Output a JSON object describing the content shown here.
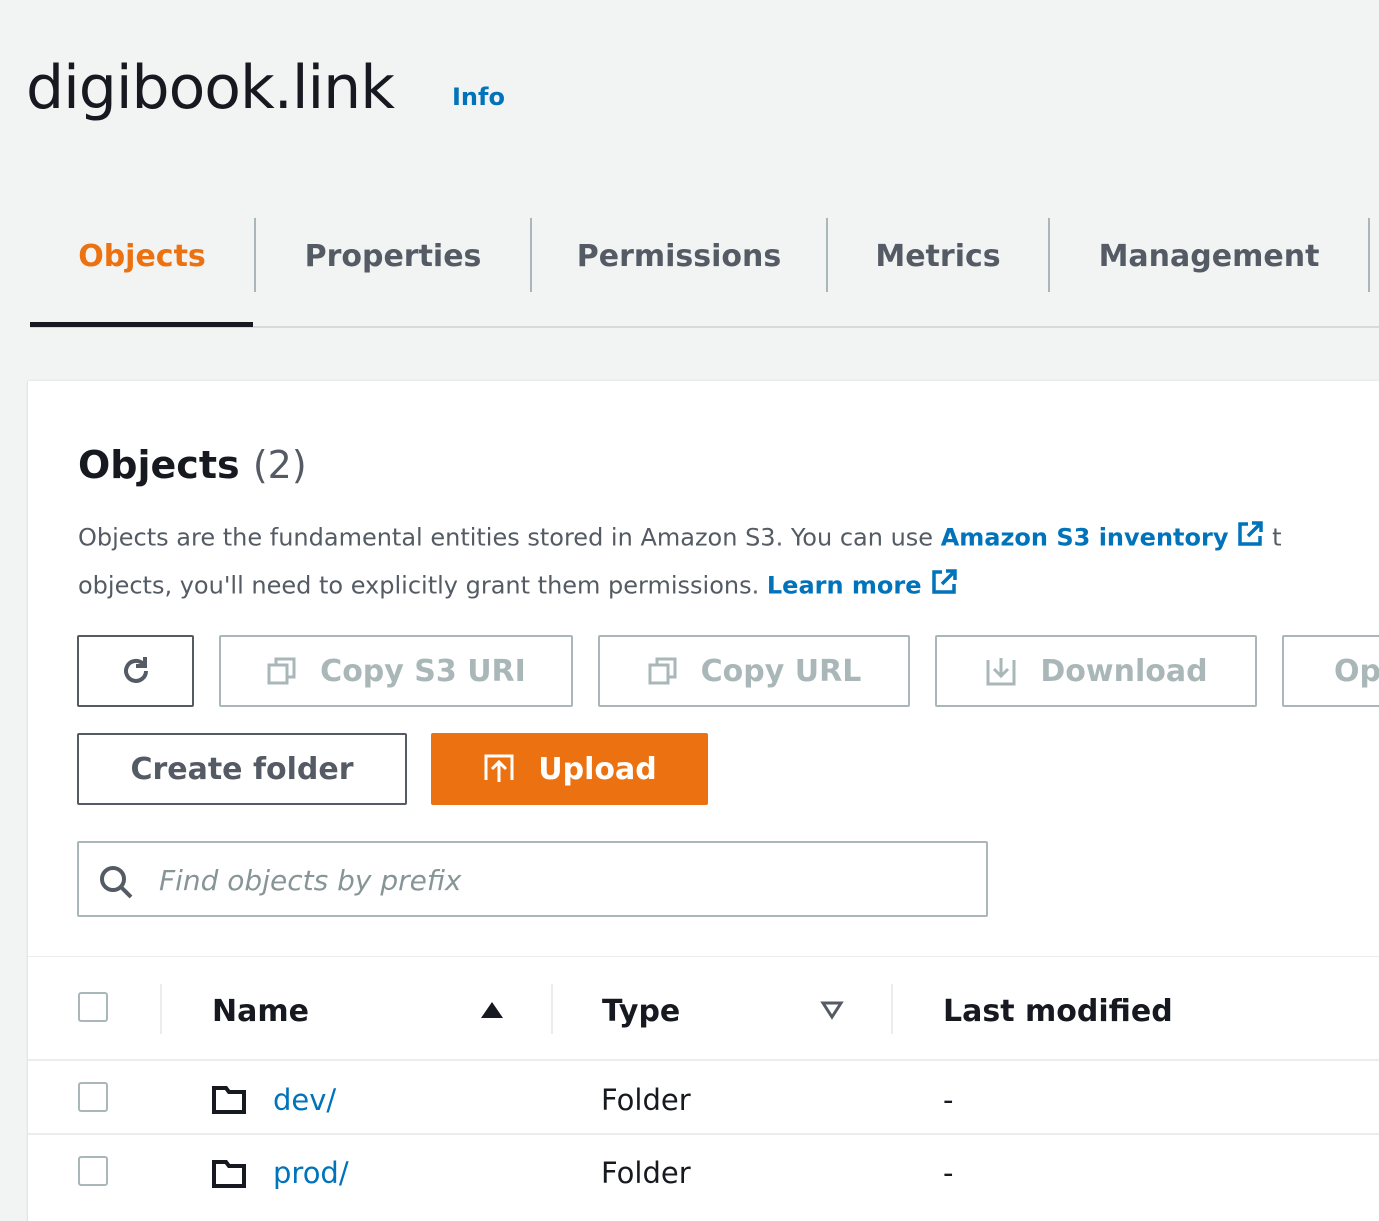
{
  "page": {
    "title": "digibook.link",
    "info_label": "Info"
  },
  "tabs": [
    "Objects",
    "Properties",
    "Permissions",
    "Metrics",
    "Management"
  ],
  "active_tab": "Objects",
  "objects_panel": {
    "heading": "Objects",
    "count": "(2)",
    "description_line1_text": "Objects are the fundamental entities stored in Amazon S3. You can use ",
    "description_line1_link": "Amazon S3 inventory",
    "description_line1_trail": "t",
    "description_line2_text": "objects, you'll need to explicitly grant them permissions. ",
    "description_line2_link": "Learn more"
  },
  "actions": {
    "refresh_icon": "refresh-icon",
    "copy_s3_uri": "Copy S3 URI",
    "copy_url": "Copy URL",
    "download": "Download",
    "open": "Op",
    "create_folder": "Create folder",
    "upload": "Upload"
  },
  "search": {
    "placeholder": "Find objects by prefix",
    "value": ""
  },
  "table": {
    "columns": [
      "Name",
      "Type",
      "Last modified"
    ],
    "sort": {
      "Name": "ascending",
      "Type": "none"
    },
    "rows": [
      {
        "name": "dev/",
        "type": "Folder",
        "last_modified": "-"
      },
      {
        "name": "prod/",
        "type": "Folder",
        "last_modified": "-"
      }
    ]
  },
  "colors": {
    "accent": "#ec7211",
    "link": "#0073bb",
    "text": "#16191f",
    "muted": "#545b64",
    "disabled": "#aab7b8"
  }
}
